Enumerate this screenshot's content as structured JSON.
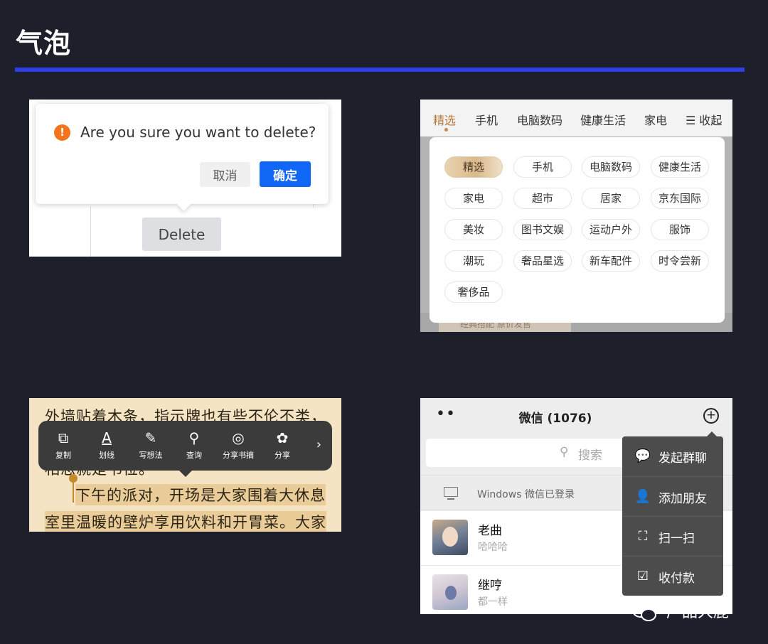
{
  "page": {
    "title": "气泡"
  },
  "delete_confirm": {
    "question": "Are you sure you want to delete?",
    "cancel_label": "取消",
    "confirm_label": "确定",
    "delete_label": "Delete",
    "warn_glyph": "!"
  },
  "category": {
    "tabs": [
      "精选",
      "手机",
      "电脑数码",
      "健康生活",
      "家电",
      "☰ 收起"
    ],
    "chips": [
      "精选",
      "手机",
      "电脑数码",
      "健康生活",
      "家电",
      "超市",
      "居家",
      "京东国际",
      "美妆",
      "图书文娱",
      "运动户外",
      "服饰",
      "潮玩",
      "奢品星选",
      "新车配件",
      "时令尝新",
      "奢侈品"
    ],
    "under_text": "经典搭配 原价发售"
  },
  "reader": {
    "lines": [
      "外墙贴着木条，指示牌也有些不伦不类，",
      "相思就是书位。",
      "下午的派对，开场是大家围着大休息",
      "室里温暖的壁炉享用饮料和开胃菜。大家"
    ],
    "tools": [
      {
        "glyph": "⧉",
        "label": "复制"
      },
      {
        "glyph": "A",
        "label": "划线"
      },
      {
        "glyph": "✎",
        "label": "写想法"
      },
      {
        "glyph": "⚲",
        "label": "查询"
      },
      {
        "glyph": "◎",
        "label": "分享书摘"
      },
      {
        "glyph": "✿",
        "label": "分享"
      }
    ],
    "more": "›"
  },
  "wechat": {
    "dots": "••",
    "title": "微信 (1076)",
    "plus": "+",
    "search_placeholder": "搜索",
    "search_glyph": "⚲",
    "windows_status": "Windows 微信已登录",
    "chats": [
      {
        "name": "老曲",
        "message": "哈哈哈"
      },
      {
        "name": "继哼",
        "message": "都一样"
      }
    ],
    "menu": [
      {
        "glyph": "💬",
        "label": "发起群聊"
      },
      {
        "glyph": "👤",
        "label": "添加朋友"
      },
      {
        "glyph": "⛶",
        "label": "扫一扫"
      },
      {
        "glyph": "☑",
        "label": "收付款"
      }
    ]
  },
  "watermark": {
    "text": "产品大鹿"
  }
}
